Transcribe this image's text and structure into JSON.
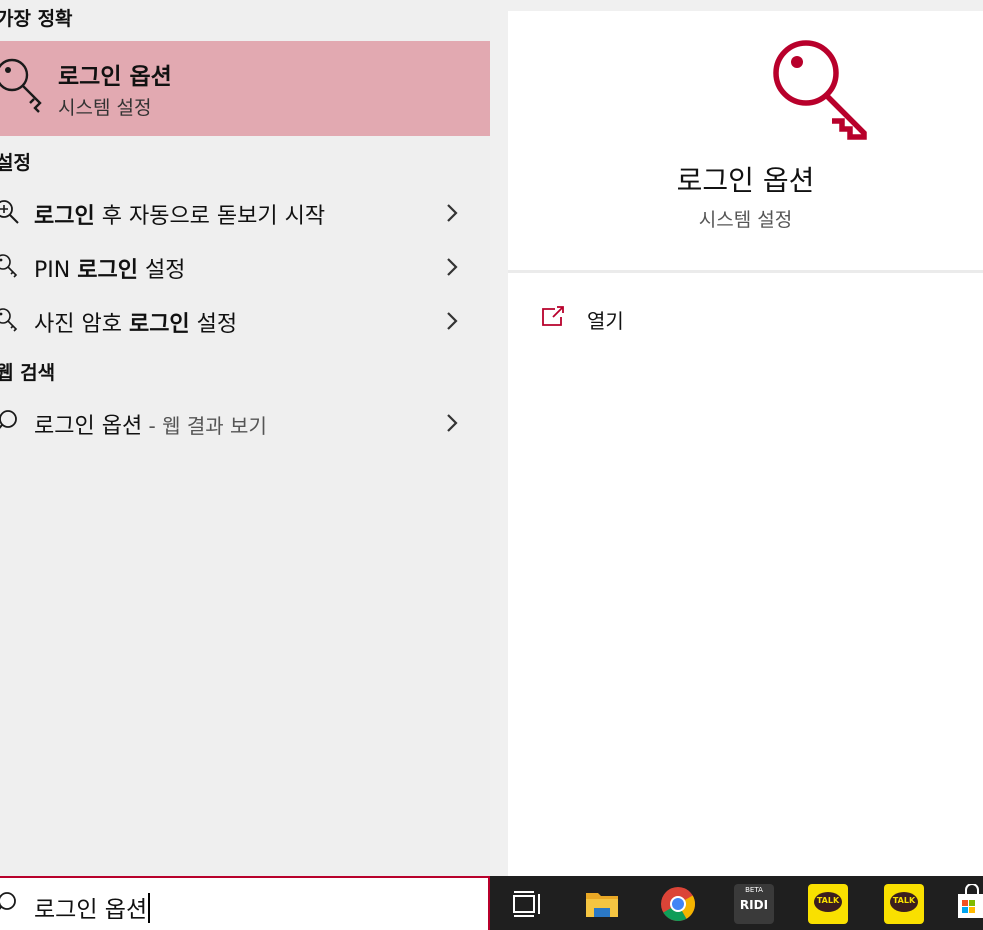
{
  "sections": {
    "best_match": "가장 정확",
    "settings": "설정",
    "web_search": "웹 검색"
  },
  "best_match": {
    "title": "로그인 옵션",
    "subtitle": "시스템 설정",
    "icon": "key-icon"
  },
  "settings_results": [
    {
      "bold": "로그인",
      "after": " 후 자동으로 돋보기 시작",
      "icon": "magnifier-icon"
    },
    {
      "before": "PIN ",
      "bold": "로그인",
      "after": " 설정",
      "icon": "key-icon"
    },
    {
      "before": "사진 암호 ",
      "bold": "로그인",
      "after": " 설정",
      "icon": "key-icon"
    }
  ],
  "web_result": {
    "main": "로그인 옵션",
    "suffix": " - 웹 결과 보기",
    "icon": "search-icon"
  },
  "preview": {
    "title": "로그인 옵션",
    "subtitle": "시스템 설정",
    "open_label": "열기",
    "open_icon": "open-external-icon"
  },
  "search": {
    "query": "로그인 옵션"
  },
  "taskbar": {
    "items": [
      "task-view-icon",
      "file-explorer-icon",
      "chrome-icon",
      "ridi-icon",
      "kakaotalk-icon",
      "kakaotalk-icon",
      "store-icon"
    ],
    "ridi_badge": "BETA",
    "ridi_label": "RIDI",
    "talk_label": "TALK"
  },
  "colors": {
    "accent": "#b8002b",
    "selected_bg": "#e2a9b1"
  }
}
